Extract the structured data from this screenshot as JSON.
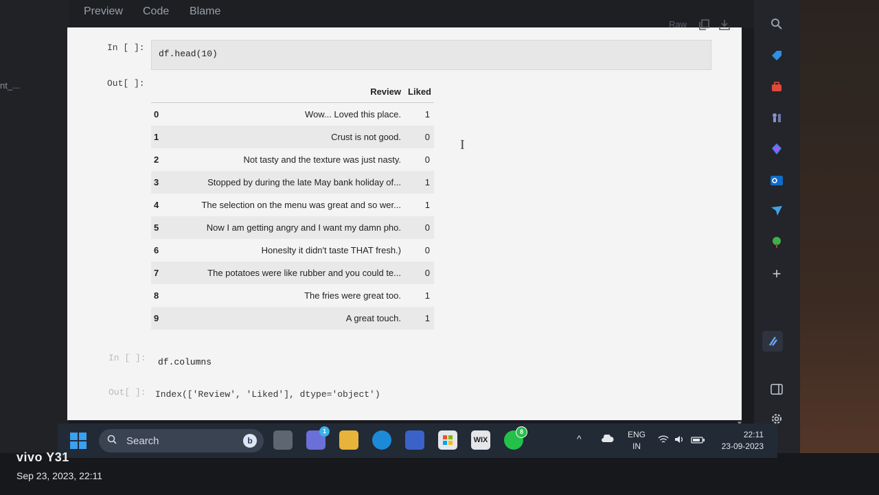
{
  "left_pane": {
    "truncated_label": "nt_..."
  },
  "file_tabs": [
    {
      "label": "Preview"
    },
    {
      "label": "Code"
    },
    {
      "label": "Blame"
    }
  ],
  "file_actions": {
    "raw_label": "Raw",
    "copy_icon": "copy-icon",
    "download_icon": "download-icon"
  },
  "cells": {
    "c1": {
      "in_prompt": "In [ ]:",
      "code": "df.head(10)",
      "out_prompt": "Out[ ]:"
    },
    "c2": {
      "in_prompt": "In [ ]:",
      "code": "df.columns",
      "out_prompt": "Out[ ]:",
      "output": "Index(['Review', 'Liked'], dtype='object')"
    }
  },
  "dataframe": {
    "columns": [
      "Review",
      "Liked"
    ],
    "rows": [
      {
        "index": "0",
        "review": "Wow... Loved this place.",
        "liked": "1"
      },
      {
        "index": "1",
        "review": "Crust is not good.",
        "liked": "0"
      },
      {
        "index": "2",
        "review": "Not tasty and the texture was just nasty.",
        "liked": "0"
      },
      {
        "index": "3",
        "review": "Stopped by during the late May bank holiday of...",
        "liked": "1"
      },
      {
        "index": "4",
        "review": "The selection on the menu was great and so wer...",
        "liked": "1"
      },
      {
        "index": "5",
        "review": "Now I am getting angry and I want my damn pho.",
        "liked": "0"
      },
      {
        "index": "6",
        "review": "Honeslty it didn't taste THAT fresh.)",
        "liked": "0"
      },
      {
        "index": "7",
        "review": "The potatoes were like rubber and you could te...",
        "liked": "0"
      },
      {
        "index": "8",
        "review": "The fries were great too.",
        "liked": "1"
      },
      {
        "index": "9",
        "review": "A great touch.",
        "liked": "1"
      }
    ]
  },
  "taskbar": {
    "search_label": "Search",
    "chat_badge": "1",
    "whatsapp_badge": "8",
    "wix_label": "WIX",
    "lang_line1": "ENG",
    "lang_line2": "IN",
    "time": "22:11",
    "date": "23-09-2023"
  },
  "watermark": {
    "brand": "vivo Y31",
    "datetime": "Sep 23, 2023, 22:11"
  },
  "colors": {
    "accent": "#3aa0f0",
    "taskbar": "#222a36",
    "paper": "#f4f4f4"
  }
}
